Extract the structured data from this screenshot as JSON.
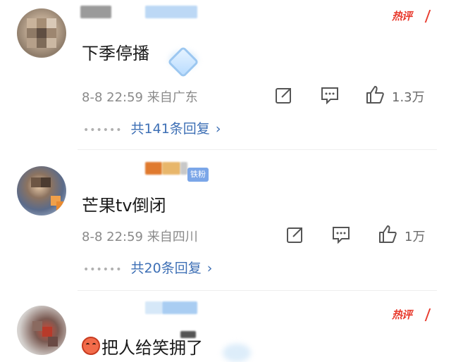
{
  "comments": [
    {
      "text": "下季停播",
      "meta": "8-8 22:59  来自广东",
      "likes": "1.3万",
      "replies": "共141条回复",
      "hot_badge": "热评",
      "avatar_icon": "avatar-dog",
      "sticker_icon": "diamond-sticker-icon"
    },
    {
      "text": "芒果tv倒闭",
      "meta": "8-8 22:59  来自四川",
      "likes": "1万",
      "replies": "共20条回复",
      "fan_badge": "铁粉",
      "avatar_icon": "avatar-person"
    },
    {
      "text": "把人给笑拥了",
      "hot_badge": "热评",
      "emoji_icon": "laughing-emoji-icon",
      "avatar_icon": "avatar-figure"
    }
  ],
  "colors": {
    "reply_link": "#3d6fb5",
    "hot_badge": "#e83a2d",
    "fan_badge": "#7ba6e8",
    "meta_text": "#8a8a8a"
  },
  "icons": [
    "share-icon",
    "comment-icon",
    "like-icon",
    "chevron-right-icon"
  ]
}
